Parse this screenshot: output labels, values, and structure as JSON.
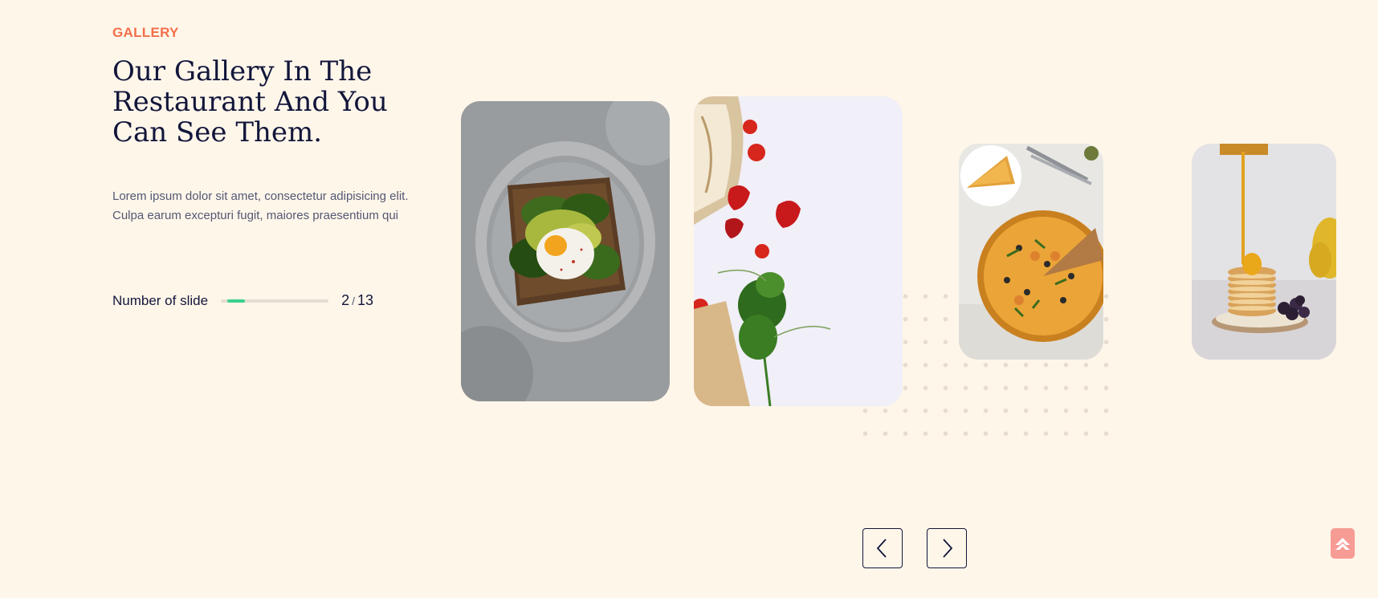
{
  "section": {
    "eyebrow": "GALLERY",
    "title": "Our Gallery In The Restaurant And You Can See Them.",
    "description": "Lorem ipsum dolor sit amet, consectetur adipisicing elit. Culpa earum excepturi fugit, maiores praesentium qui"
  },
  "slider": {
    "label": "Number of slide",
    "current": "2",
    "separator": "/",
    "total": "13",
    "progress_fraction": 0.15
  },
  "gallery": {
    "cards": [
      {
        "subject": "avocado toast with poached egg on grey plate"
      },
      {
        "subject": "bread, strawberries, tomatoes and herbs on marble"
      },
      {
        "subject": "pizza with olives and herbs"
      },
      {
        "subject": "stack of pancakes with honey drizzle"
      }
    ]
  },
  "controls": {
    "prev_icon": "chevron-left-icon",
    "next_icon": "chevron-right-icon",
    "top_icon": "arrow-up-icon"
  },
  "colors": {
    "background": "#fff6ea",
    "accent": "#f26f4a",
    "heading": "#12163a",
    "progress": "#3ccf8e",
    "back_to_top": "#f79b95"
  }
}
